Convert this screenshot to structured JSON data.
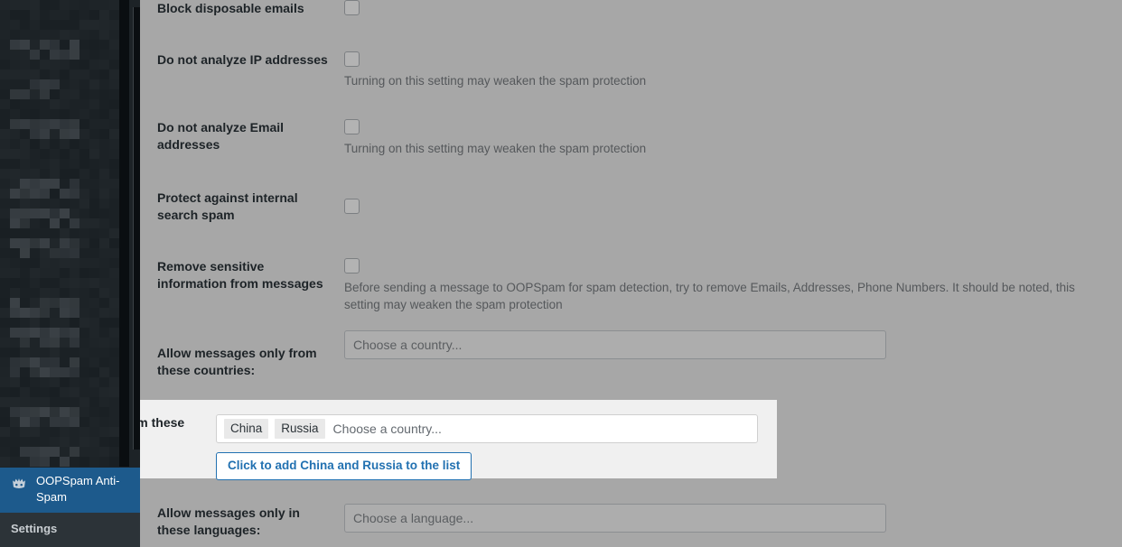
{
  "sidebar": {
    "active_item": {
      "label": "OOPSpam Anti-Spam",
      "icon": "shield-crown-icon"
    },
    "submenu_items": [
      {
        "label": "Settings"
      }
    ],
    "redacted_note": "blurred-menu-items"
  },
  "colors": {
    "wp_blue": "#2271b1",
    "sidebar_bg": "#1d2327",
    "sidebar_active_bg": "#1d5a8c",
    "submenu_bg": "#2c3338",
    "overlay_grey": "#a7a7a7",
    "highlight_bg": "#f0f0f0"
  },
  "settings_rows": [
    {
      "label": "Block disposable emails",
      "control": "checkbox",
      "checked": false,
      "description": ""
    },
    {
      "label": "Do not analyze IP addresses",
      "control": "checkbox",
      "checked": false,
      "description": "Turning on this setting may weaken the spam protection"
    },
    {
      "label": "Do not analyze Email addresses",
      "control": "checkbox",
      "checked": false,
      "description": "Turning on this setting may weaken the spam protection"
    },
    {
      "label": "Protect against internal search spam",
      "control": "checkbox",
      "checked": false,
      "description": ""
    },
    {
      "label": "Remove sensitive information from messages",
      "control": "checkbox",
      "checked": false,
      "description": "Before sending a message to OOPSpam for spam detection, try to remove Emails, Addresses, Phone Numbers. It should be noted, this setting may weaken the spam protection"
    },
    {
      "label": "Allow messages only from these countries:",
      "control": "multiselect",
      "placeholder": "Choose a country...",
      "tags": []
    },
    {
      "label": "Allow messages only in these languages:",
      "control": "multiselect",
      "placeholder": "Choose a language...",
      "tags": []
    }
  ],
  "highlighted_row": {
    "label": "Block messages from these countries:",
    "placeholder": "Choose a country...",
    "tags": [
      "China",
      "Russia"
    ],
    "action_button_label": "Click to add China and Russia to the list"
  }
}
